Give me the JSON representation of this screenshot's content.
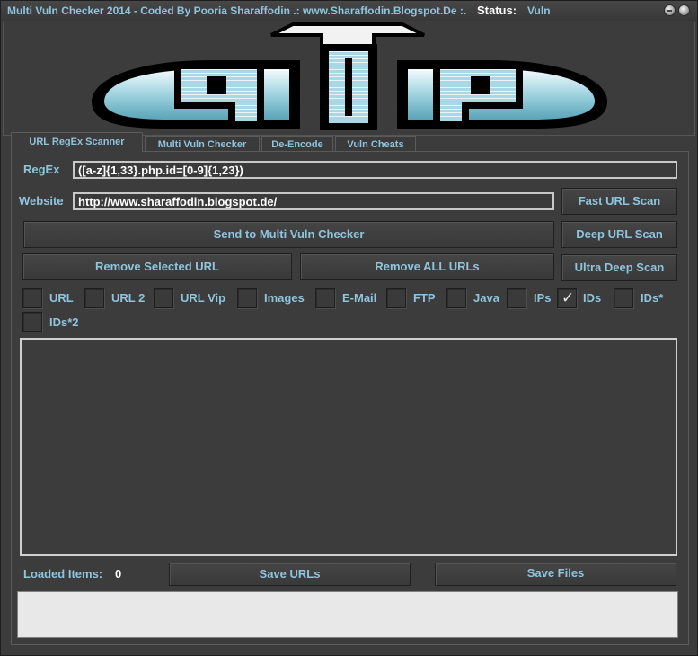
{
  "window": {
    "title": "Multi Vuln Checker 2014 - Coded By Pooria Sharaffodin  .: www.Sharaffodin.Blogspot.De :.",
    "status_label": "Status:",
    "status_value": "Vuln"
  },
  "tabs": [
    {
      "label": "URL RegEx Scanner",
      "active": true
    },
    {
      "label": "Multi Vuln Checker",
      "active": false
    },
    {
      "label": "De-Encode",
      "active": false
    },
    {
      "label": "Vuln Cheats",
      "active": false
    }
  ],
  "form": {
    "regex_label": "RegEx",
    "regex_value": "([a-z]{1,33}.php.id=[0-9]{1,23})",
    "website_label": "Website",
    "website_value": "http://www.sharaffodin.blogspot.de/"
  },
  "buttons": {
    "fast_scan": "Fast URL Scan",
    "deep_scan": "Deep URL Scan",
    "ultra_deep_scan": "Ultra Deep Scan",
    "send_to_checker": "Send to Multi Vuln Checker",
    "remove_selected": "Remove Selected URL",
    "remove_all": "Remove ALL URLs",
    "save_urls": "Save URLs",
    "save_files": "Save Files"
  },
  "checkboxes": [
    {
      "label": "URL",
      "checked": false
    },
    {
      "label": "URL 2",
      "checked": false
    },
    {
      "label": "URL Vip",
      "checked": false
    },
    {
      "label": "Images",
      "checked": false
    },
    {
      "label": "E-Mail",
      "checked": false
    },
    {
      "label": "FTP",
      "checked": false
    },
    {
      "label": "Java",
      "checked": false
    },
    {
      "label": "IPs",
      "checked": false
    },
    {
      "label": "IDs",
      "checked": true
    },
    {
      "label": "IDs*",
      "checked": false
    },
    {
      "label": "IDs*2",
      "checked": false
    }
  ],
  "footer": {
    "loaded_label": "Loaded Items:",
    "loaded_value": "0"
  },
  "banner_logo_letters": "PIP",
  "colors": {
    "accent": "#8fc4dd",
    "background": "#3c3c3c",
    "logo_fill": "#9fd3e0"
  },
  "icons": {
    "checkmark": "✓"
  }
}
